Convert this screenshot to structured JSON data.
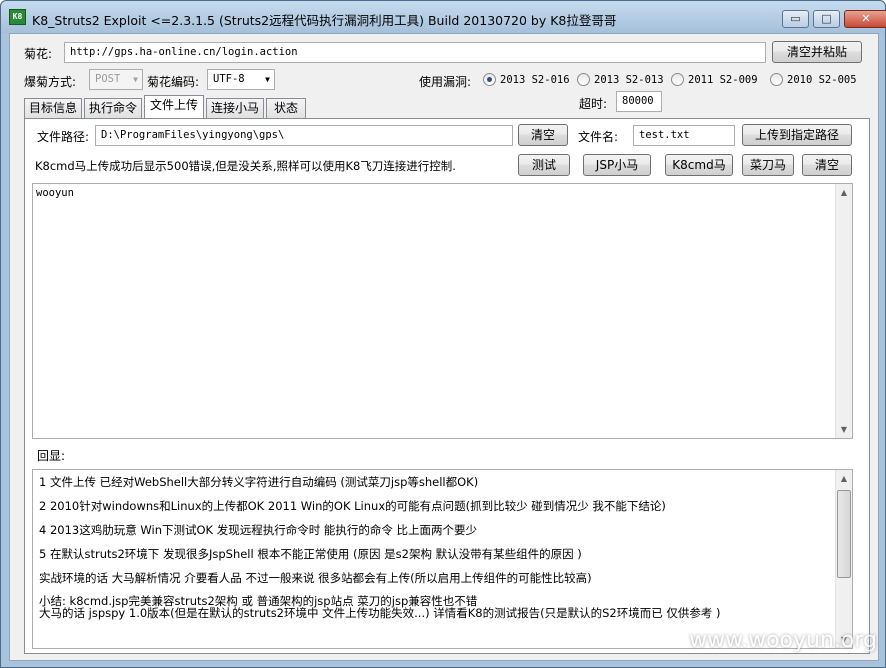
{
  "window": {
    "icon_text": "K8",
    "title": "K8_Struts2 Exploit <=2.3.1.5   (Struts2远程代码执行漏洞利用工具)  Build 20130720   by K8拉登哥哥",
    "minimize": "▭",
    "maximize": "□",
    "close": "✕"
  },
  "top": {
    "url_label": "菊花:",
    "url_value": "http://gps.ha-online.cn/login.action",
    "clear_paste_button": "清空并粘贴",
    "method_label": "爆菊方式:",
    "method_value": "POST",
    "encoding_label": "菊花编码:",
    "encoding_value": "UTF-8",
    "vuln_label": "使用漏洞:",
    "vuln_options": [
      {
        "label": "2013 S2-016",
        "checked": true
      },
      {
        "label": "2013 S2-013",
        "checked": false
      },
      {
        "label": "2011  S2-009",
        "checked": false
      },
      {
        "label": "2010 S2-005",
        "checked": false
      }
    ],
    "timeout_label": "超时:",
    "timeout_value": "80000"
  },
  "tabs": [
    {
      "label": "目标信息",
      "active": false
    },
    {
      "label": "执行命令",
      "active": false
    },
    {
      "label": "文件上传",
      "active": true
    },
    {
      "label": "连接小马",
      "active": false
    },
    {
      "label": "状态",
      "active": false
    }
  ],
  "upload": {
    "path_label": "文件路径:",
    "path_value": "D:\\ProgramFiles\\yingyong\\gps\\",
    "clear_button": "清空",
    "filename_label": "文件名:",
    "filename_value": "test.txt",
    "upload_button": "上传到指定路径",
    "note": "K8cmd马上传成功后显示500错误,但是没关系,照样可以使用K8飞刀连接进行控制.",
    "test_button": "测试",
    "jsp_button": "JSP小马",
    "k8cmd_button": "K8cmd马",
    "caidao_button": "菜刀马",
    "clear2_button": "清空",
    "content_value": "wooyun"
  },
  "echo": {
    "label": "回显:",
    "lines": [
      "1 文件上传  已经对WebShell大部分转义字符进行自动编码  (测试菜刀jsp等shell都OK)",
      "2 2010针对windowns和Linux的上传都OK     2011 Win的OK Linux的可能有点问题(抓到比较少  碰到情况少  我不能下结论)",
      "4 2013这鸡肋玩意  Win下测试OK  发现远程执行命令时  能执行的命令  比上面两个要少",
      "5 在默认struts2环境下  发现很多JspShell  根本不能正常使用  (原因  是s2架构  默认没带有某些组件的原因 )",
      "   实战环境的话  大马解析情况  介要看人品  不过一般来说  很多站都会有上传(所以启用上传组件的可能性比较高)",
      "   小结:  k8cmd.jsp完美兼容struts2架构  或  普通架构的jsp站点  菜刀的jsp兼容性也不错",
      "   大马的话  jspspy 1.0版本(但是在默认的struts2环境中  文件上传功能失效...)        详情看K8的测试报告(只是默认的S2环境而已  仅供参考 )"
    ]
  },
  "watermark": "www.wooyun.org"
}
